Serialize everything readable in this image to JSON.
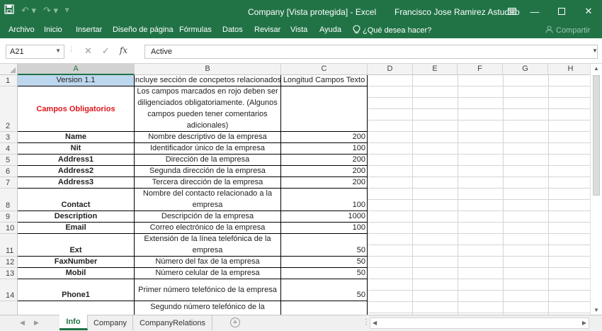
{
  "titlebar": {
    "title": "Company  [Vista protegida]  -  Excel",
    "user": "Francisco Jose Ramirez Astudillo"
  },
  "ribbon": {
    "tabs": [
      "Archivo",
      "Inicio",
      "Insertar",
      "Diseño de página",
      "Fórmulas",
      "Datos",
      "Revisar",
      "Vista",
      "Ayuda"
    ],
    "tell_me": "¿Qué desea hacer?",
    "share": "Compartir"
  },
  "formula_bar": {
    "name_box": "A21",
    "value": "Active",
    "fx": "fx"
  },
  "columns": [
    "A",
    "B",
    "C",
    "D",
    "E",
    "F",
    "G",
    "H"
  ],
  "rows": [
    {
      "num": "1",
      "a": "Version 1.1",
      "b": "Se incluye sección  de concpetos relacionados",
      "c": "Longitud Campos Texto"
    },
    {
      "num": "2",
      "a": "Campos Obligatorios",
      "b": "Los campos marcados en rojo deben ser diligenciados obligatoriamente. (Algunos campos pueden tener comentarios adicionales)",
      "c": ""
    },
    {
      "num": "3",
      "a": "Name",
      "b": "Nombre descriptivo de la empresa",
      "c": "200"
    },
    {
      "num": "4",
      "a": "Nit",
      "b": "Identificador único de la empresa",
      "c": "100"
    },
    {
      "num": "5",
      "a": "Address1",
      "b": "Dirección de la empresa",
      "c": "200"
    },
    {
      "num": "6",
      "a": "Address2",
      "b": "Segunda dirección de la empresa",
      "c": "200"
    },
    {
      "num": "7",
      "a": "Address3",
      "b": "Tercera dirección de la empresa",
      "c": "200"
    },
    {
      "num": "8",
      "a": "Contact",
      "b": "Nombre del contacto relacionado a la empresa",
      "c": "100"
    },
    {
      "num": "9",
      "a": "Description",
      "b": "Descripción de la empresa",
      "c": "1000"
    },
    {
      "num": "10",
      "a": "Email",
      "b": "Correo electrónico de la empresa",
      "c": "100"
    },
    {
      "num": "11",
      "a": "Ext",
      "b": "Extensión de la línea telefónica de la empresa",
      "c": "50"
    },
    {
      "num": "12",
      "a": "FaxNumber",
      "b": "Número del fax de la empresa",
      "c": "50"
    },
    {
      "num": "13",
      "a": "Mobil",
      "b": "Número celular de la empresa",
      "c": "50"
    },
    {
      "num": "14",
      "a": "Phone1",
      "b": "Primer número telefónico de la empresa",
      "c": "50"
    },
    {
      "num": "",
      "a": "",
      "b": "Segundo número telefónico de la",
      "c": ""
    }
  ],
  "sheets": [
    "Info",
    "Company",
    "CompanyRelations"
  ],
  "active_sheet": "Info",
  "colors": {
    "excel_green": "#217346",
    "required_red": "#e0171f",
    "header_blue": "#bdd7ee"
  }
}
